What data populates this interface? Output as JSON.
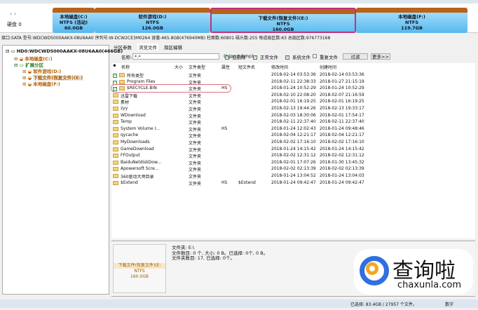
{
  "disk": {
    "nav": "‹ ›",
    "label": "硬盘 0",
    "partitions": [
      {
        "name": "本地磁盘(C:)",
        "fs": "NTFS (活动)",
        "size": "60.0GB"
      },
      {
        "name": "软件游戏(D:)",
        "fs": "NTFS",
        "size": "126.0GB"
      },
      {
        "name": "下载文件(恢复文件)(E:)",
        "fs": "NTFS",
        "size": "160.0GB"
      },
      {
        "name": "本地磁盘(F:)",
        "fs": "NTFS",
        "size": "119.7GB"
      }
    ],
    "info": "接口:SATA  型号:WDCWD5000AAKX-08U6AA0  序列号:W-DCW2CE3M0264  容量:465.8GB(476940MB)  柱面数:60801  磁头数:255  每道扇区数:63  总扇区数:976773168"
  },
  "tree": {
    "items": [
      "HD0:WDCWD5000AAKX-08U6AA0(466GB)",
      "本地磁盘(C:)",
      "扩展分区",
      "软件游戏(D:)",
      "下载文件(恢复文件)(E:)",
      "本地磁盘(F:)"
    ]
  },
  "tabs": [
    "分区参数",
    "浏览文件",
    "扇区编辑"
  ],
  "filter": {
    "name_label": "名称:",
    "name_value": "*.*",
    "hint": "(*.jpg;*.bmp)",
    "deleted": "已删除",
    "normal": "正常文件",
    "system": "系统文件",
    "duplicate": "重复文件",
    "filter_btn": "过滤",
    "more_btn": "更多>>"
  },
  "columns": [
    "名称",
    "大小",
    "文件类型",
    "属性",
    "短文件名",
    "修改时间",
    "创建时间"
  ],
  "rows": [
    {
      "name": "所有类型",
      "type": "文件夹",
      "attr": "",
      "short": "",
      "mod": "2018-02-14 03:53:36",
      "created": "2018-02-14 03:53:36",
      "check": true
    },
    {
      "name": "Program Files",
      "type": "文件夹",
      "attr": "",
      "short": "",
      "mod": "2018-02-11 22:38:33",
      "created": "2018-01-27 21:15:19",
      "check": true
    },
    {
      "name": "$RECYCLE.BIN",
      "type": "文件夹",
      "attr": "HS",
      "short": "",
      "mod": "2018-01-24 10:52:29",
      "created": "2018-01-24 10:52:29",
      "check": true
    },
    {
      "name": "迅雷下载",
      "type": "文件夹",
      "attr": "",
      "short": "",
      "mod": "2018-02-10 22:08:20",
      "created": "2018-02-07 21:16:59"
    },
    {
      "name": "素材",
      "type": "文件夹",
      "attr": "",
      "short": "",
      "mod": "2018-02-01 16:19:25",
      "created": "2018-02-01 16:19:25"
    },
    {
      "name": "zyy",
      "type": "文件夹",
      "attr": "",
      "short": "",
      "mod": "2018-02-13 19:44:26",
      "created": "2018-02-13 19:33:17"
    },
    {
      "name": "WDownload",
      "type": "文件夹",
      "attr": "",
      "short": "",
      "mod": "2018-02-03 18:30:06",
      "created": "2018-02-01 17:54:17"
    },
    {
      "name": "Temp",
      "type": "文件夹",
      "attr": "",
      "short": "",
      "mod": "2018-02-11 22:37:40",
      "created": "2018-02-11 22:37:40"
    },
    {
      "name": "System Volume I...",
      "type": "文件夹",
      "attr": "HS",
      "short": "",
      "mod": "2018-01-24 12:02:43",
      "created": "2018-01-24 09:48:46"
    },
    {
      "name": "qycache",
      "type": "文件夹",
      "attr": "",
      "short": "",
      "mod": "2018-02-04 12:21:17",
      "created": "2018-02-04 12:21:17"
    },
    {
      "name": "MyDownloads",
      "type": "文件夹",
      "attr": "",
      "short": "",
      "mod": "2018-02-02 17:16:10",
      "created": "2018-02-02 17:16:10"
    },
    {
      "name": "GameDownload",
      "type": "文件夹",
      "attr": "",
      "short": "",
      "mod": "2018-01-24 14:15:42",
      "created": "2018-01-24 14:15:42"
    },
    {
      "name": "FFOutput",
      "type": "文件夹",
      "attr": "",
      "short": "",
      "mod": "2018-02-02 12:31:12",
      "created": "2018-02-02 12:31:12"
    },
    {
      "name": "BaiduNetdiskDow...",
      "type": "文件夹",
      "attr": "",
      "short": "",
      "mod": "2018-02-01 17:07:26",
      "created": "2018-01-30 13:45:32"
    },
    {
      "name": "Apowersoft Scre...",
      "type": "文件夹",
      "attr": "",
      "short": "",
      "mod": "2018-02-02 02:13:39",
      "created": "2018-02-02 02:13:39"
    },
    {
      "name": "360驱动大师目录",
      "type": "文件夹",
      "attr": "",
      "short": "",
      "mod": "2018-01-24 13:04:52",
      "created": "2018-01-24 13:04:03"
    },
    {
      "name": "$Extend",
      "type": "文件夹",
      "attr": "HS",
      "short": "$Extend",
      "mod": "2018-01-24 09:42:47",
      "created": "2018-01-24 09:42:47"
    }
  ],
  "detail": {
    "name": "下载文件(恢复文件)(E:",
    "fs": "NTFS",
    "size": "160.0GB",
    "line1": "文件夹: E:\\",
    "line2": "文件数目: 0 个, 大小: 0 B。已选择: 0个, 0 B。",
    "line3": "文件夹数目: 17, 已选择: 0个。"
  },
  "status": {
    "selected": "已选择: 83.4GB / 27957 个文件。",
    "mode": "数字"
  },
  "watermark": {
    "cn": "查询啦",
    "en": "chaxunla.com"
  }
}
